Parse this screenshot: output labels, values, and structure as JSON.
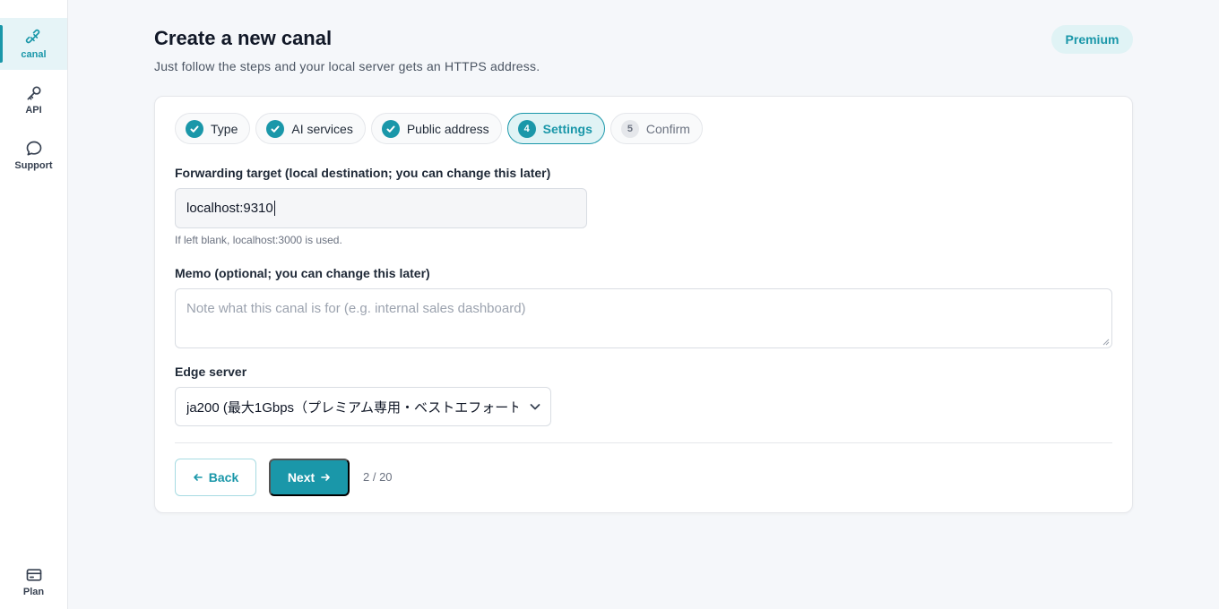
{
  "sidebar": {
    "items": [
      {
        "label": "canal",
        "icon": "link-plug-icon",
        "active": true
      },
      {
        "label": "API",
        "icon": "key-icon",
        "active": false
      },
      {
        "label": "Support",
        "icon": "chat-bubble-icon",
        "active": false
      }
    ],
    "bottom": {
      "label": "Plan",
      "icon": "credit-card-icon"
    }
  },
  "header": {
    "title": "Create a new canal",
    "subtitle": "Just follow the steps and your local server gets an HTTPS address.",
    "badge": "Premium"
  },
  "steps": [
    {
      "label": "Type",
      "state": "done"
    },
    {
      "label": "AI services",
      "state": "done"
    },
    {
      "label": "Public address",
      "state": "done"
    },
    {
      "label": "Settings",
      "number": "4",
      "state": "current"
    },
    {
      "label": "Confirm",
      "number": "5",
      "state": "pending"
    }
  ],
  "form": {
    "forwarding": {
      "label": "Forwarding target (local destination; you can change this later)",
      "value": "localhost:9310",
      "hint": "If left blank, localhost:3000 is used."
    },
    "memo": {
      "label": "Memo (optional; you can change this later)",
      "placeholder": "Note what this canal is for (e.g. internal sales dashboard)"
    },
    "edge": {
      "label": "Edge server",
      "value": "ja200 (最大1Gbps（プレミアム専用・ベストエフォート"
    }
  },
  "footer": {
    "back_label": "Back",
    "next_label": "Next",
    "counter": "2 / 20"
  },
  "colors": {
    "accent": "#1a97a9",
    "accent_light": "#e0f3f5",
    "background": "#f5f7fa"
  }
}
